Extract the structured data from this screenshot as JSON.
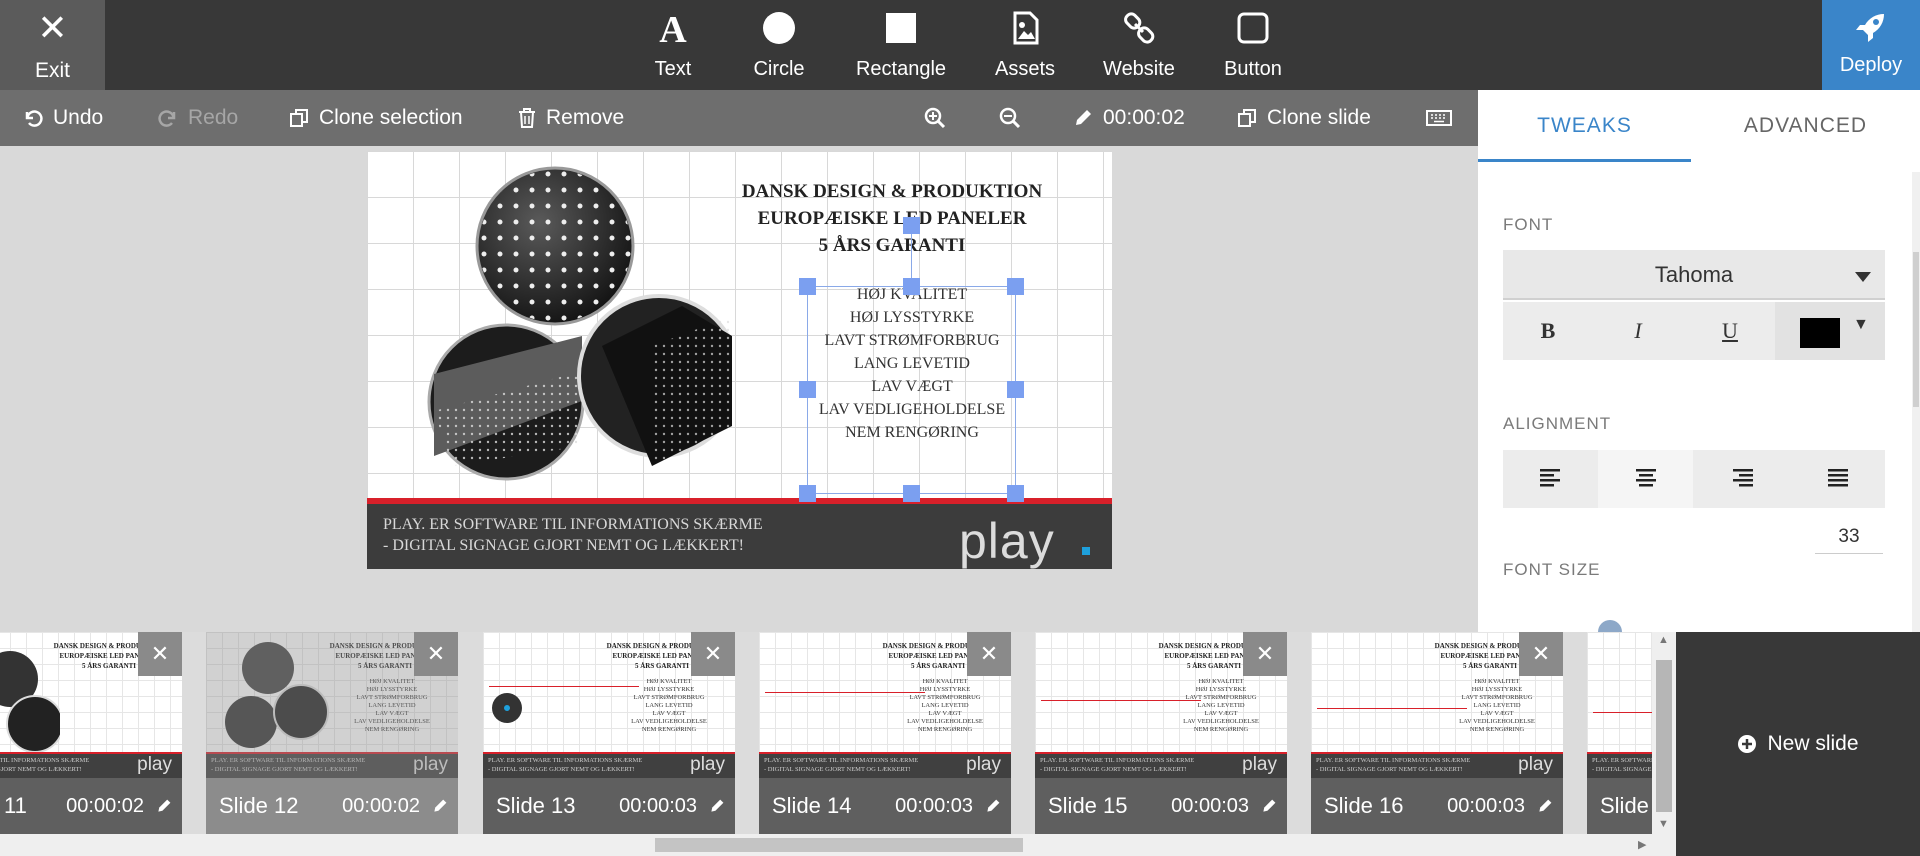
{
  "topbar": {
    "exit_label": "Exit",
    "tools": [
      {
        "label": "Text",
        "icon": "text-icon"
      },
      {
        "label": "Circle",
        "icon": "circle-icon"
      },
      {
        "label": "Rectangle",
        "icon": "rectangle-icon"
      },
      {
        "label": "Assets",
        "icon": "image-icon"
      },
      {
        "label": "Website",
        "icon": "link-icon"
      },
      {
        "label": "Button",
        "icon": "button-icon"
      }
    ],
    "deploy_label": "Deploy"
  },
  "toolbar": {
    "undo": "Undo",
    "redo": "Redo",
    "clone_selection": "Clone selection",
    "remove": "Remove",
    "duration": "00:00:02",
    "clone_slide": "Clone slide"
  },
  "slide": {
    "headings": [
      "DANSK DESIGN & PRODUKTION",
      "EUROPÆISKE LED PANELER",
      "5 ÅRS GARANTI"
    ],
    "features": [
      "HØJ KVALITET",
      "HØJ LYSSTYRKE",
      "LAVT STRØMFORBRUG",
      "LANG LEVETID",
      "LAV VÆGT",
      "LAV VEDLIGEHOLDELSE",
      "NEM RENGØRING"
    ],
    "footer_lines": [
      "PLAY. ER SOFTWARE TIL INFORMATIONS SKÆRME",
      "- DIGITAL SIGNAGE GJORT NEMT OG LÆKKERT!"
    ],
    "logo": "play"
  },
  "panel": {
    "tabs": [
      "TWEAKS",
      "ADVANCED"
    ],
    "font_label": "FONT",
    "font_value": "Tahoma",
    "bold": "B",
    "italic": "I",
    "underline": "U",
    "text_color": "#000000",
    "alignment_label": "ALIGNMENT",
    "alignment_selected": "center",
    "font_size_value": "33",
    "font_size_label": "FONT SIZE",
    "accent_color": "#3a85c9"
  },
  "filmstrip": {
    "slides": [
      {
        "name": "11",
        "time": "00:00:02"
      },
      {
        "name": "Slide 12",
        "time": "00:00:02"
      },
      {
        "name": "Slide 13",
        "time": "00:00:03"
      },
      {
        "name": "Slide 14",
        "time": "00:00:03"
      },
      {
        "name": "Slide 15",
        "time": "00:00:03"
      },
      {
        "name": "Slide 16",
        "time": "00:00:03"
      },
      {
        "name": "Slide",
        "time": ""
      }
    ],
    "thumb_headings": [
      "DANSK DESIGN & PRODUKTION",
      "EUROPÆISKE LED PANELER",
      "5 ÅRS GARANTI"
    ],
    "thumb_features": [
      "HØJ KVALITET",
      "HØJ LYSSTYRKE",
      "LAVT STRØMFORBRUG",
      "LANG LEVETID",
      "LAV VÆGT",
      "LAV VEDLIGEHOLDELSE",
      "NEM RENGØRING"
    ],
    "thumb_footer": [
      "PLAY. ER SOFTWARE TIL INFORMATIONS SKÆRME",
      "- DIGITAL SIGNAGE GJORT NEMT OG LÆKKERT!"
    ],
    "new_slide": "New slide"
  }
}
